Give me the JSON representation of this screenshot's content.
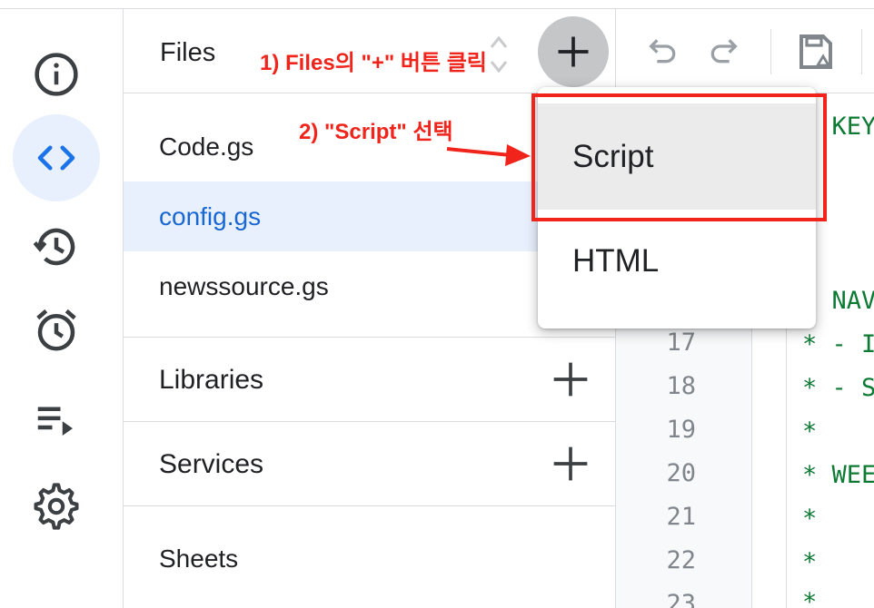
{
  "files_panel": {
    "title": "Files",
    "files": [
      {
        "name": "Code.gs",
        "selected": false
      },
      {
        "name": "config.gs",
        "selected": true
      },
      {
        "name": "newssource.gs",
        "selected": false
      }
    ],
    "sections": [
      "Libraries",
      "Services",
      "Sheets"
    ]
  },
  "rail": {
    "icons": [
      "info-icon",
      "code-icon",
      "history-icon",
      "alarm-icon",
      "executions-icon",
      "settings-icon"
    ],
    "active": "code-icon"
  },
  "menu": {
    "items": [
      "Script",
      "HTML"
    ],
    "highlighted": "Script"
  },
  "editor": {
    "line_numbers": [
      "17",
      "18",
      "19",
      "20",
      "21",
      "22",
      "23"
    ],
    "code_fragments": [
      "* KEY",
      "* NAV",
      "* - I",
      "* - S",
      "*",
      "* WEE",
      "*",
      "*",
      "*"
    ]
  },
  "annotations": {
    "step1": "1) Files의 \"+\" 버튼 클릭",
    "step2": "2) \"Script\" 선택",
    "color": "#f0241b"
  },
  "colors": {
    "selected_bg": "#e8f0fe",
    "selected_text": "#1967d2",
    "code_green": "#0d7a34"
  }
}
